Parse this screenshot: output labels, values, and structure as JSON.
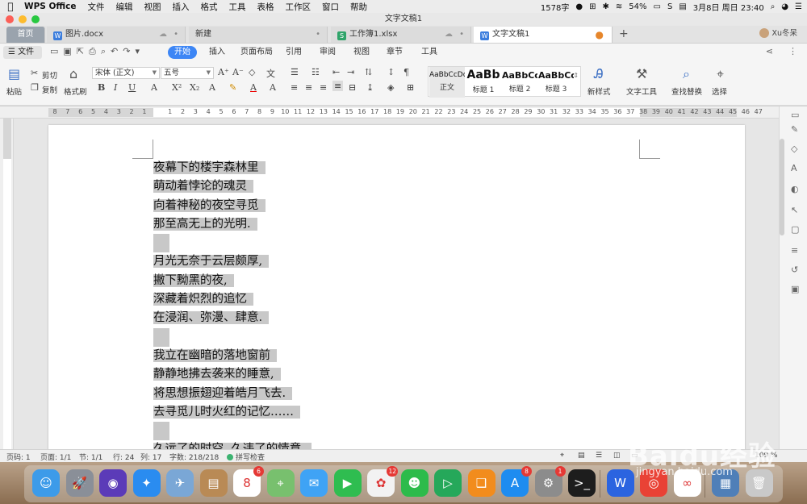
{
  "menubar": {
    "app": "WPS Office",
    "items": [
      "文件",
      "编辑",
      "视图",
      "插入",
      "格式",
      "工具",
      "表格",
      "工作区",
      "窗口",
      "帮助"
    ],
    "status": {
      "word_count": "1578字",
      "battery": "54%",
      "datetime": "3月8日 周日  23:40"
    }
  },
  "window": {
    "title": "文字文稿1"
  },
  "tabs": {
    "home": "首页",
    "items": [
      {
        "label": "图片.docx",
        "icon_color": "#3b7ddd"
      },
      {
        "label": "新建"
      },
      {
        "label": "工作簿1.xlsx",
        "icon_color": "#2fa46a"
      },
      {
        "label": "文字文稿1",
        "icon_color": "#3b7ddd"
      }
    ],
    "new_tab": "+",
    "user": "Xu冬呆"
  },
  "menu_row": {
    "file": "文件",
    "tabs": [
      "开始",
      "插入",
      "页面布局",
      "引用",
      "审阅",
      "视图",
      "章节",
      "工具"
    ]
  },
  "ribbon": {
    "paste": "粘贴",
    "cut": "剪切",
    "copy": "复制",
    "format_painter": "格式刷",
    "font_name": "宋体 (正文)",
    "font_size": "五号",
    "styles": [
      {
        "sample": "AaBbCcDd",
        "name": "正文"
      },
      {
        "sample": "AaBb",
        "name": "标题 1"
      },
      {
        "sample": "AaBbCc",
        "name": "标题 2"
      },
      {
        "sample": "AaBbCc",
        "name": "标题 3"
      }
    ],
    "new_style": "新样式",
    "text_tools": "文字工具",
    "find_replace": "查找替换",
    "select": "选择"
  },
  "ruler": {
    "ticks": [
      "8",
      "7",
      "6",
      "5",
      "4",
      "3",
      "2",
      "1",
      "",
      "1",
      "2",
      "3",
      "4",
      "5",
      "6",
      "7",
      "8",
      "9",
      "10",
      "11",
      "12",
      "13",
      "14",
      "15",
      "16",
      "17",
      "18",
      "19",
      "20",
      "21",
      "22",
      "23",
      "24",
      "25",
      "26",
      "27",
      "28",
      "29",
      "30",
      "31",
      "32",
      "33",
      "34",
      "35",
      "36",
      "37",
      "38",
      "39",
      "40",
      "41",
      "42",
      "43",
      "44",
      "45",
      "46",
      "47"
    ]
  },
  "document": {
    "lines": [
      "夜幕下的楼宇森林里",
      "萌动着悖论的魂灵",
      "向着神秘的夜空寻觅",
      "那至高无上的光明.",
      "",
      "月光无奈于云层颇厚,",
      "撇下黝黑的夜,",
      "深藏着炽烈的追忆",
      "在浸润、弥漫、肆意.",
      "",
      "我立在幽暗的落地窗前",
      "静静地拂去袭来的睡意,",
      "将思想振翅迎着皓月飞去.",
      "去寻觅儿时火红的记忆……",
      "",
      "久远了的时空, 久违了的情意."
    ]
  },
  "statusbar": {
    "page_no": "页码: 1",
    "pages": "页面: 1/1",
    "section": "节: 1/1",
    "row": "行: 24",
    "col": "列: 17",
    "chars": "字数: 218/218",
    "spell": "拼写检查",
    "zoom": "109 %"
  },
  "dock": {
    "apps": [
      {
        "name": "finder",
        "color": "#3d9be9",
        "glyph": "☺"
      },
      {
        "name": "launchpad",
        "color": "#8a8f98",
        "glyph": "🚀"
      },
      {
        "name": "siri",
        "color": "#5b3bb8",
        "glyph": "◉"
      },
      {
        "name": "safari",
        "color": "#2a8cf0",
        "glyph": "✦"
      },
      {
        "name": "preview",
        "color": "#7aa7d6",
        "glyph": "✈"
      },
      {
        "name": "contacts",
        "color": "#b98a55",
        "glyph": "▤"
      },
      {
        "name": "calendar",
        "color": "#ffffff",
        "glyph": "8",
        "badge": "6"
      },
      {
        "name": "maps",
        "color": "#78c06e",
        "glyph": "⌖"
      },
      {
        "name": "messages",
        "color": "#3fa3f5",
        "glyph": "✉"
      },
      {
        "name": "facetime",
        "color": "#2fbd50",
        "glyph": "▶"
      },
      {
        "name": "photos",
        "color": "#f2f2f2",
        "glyph": "✿",
        "badge": "12"
      },
      {
        "name": "wechat",
        "color": "#2dbb4b",
        "glyph": "☻"
      },
      {
        "name": "media",
        "color": "#25a85a",
        "glyph": "▷"
      },
      {
        "name": "books",
        "color": "#f28c1d",
        "glyph": "❑"
      },
      {
        "name": "app-store",
        "color": "#1e8cf0",
        "glyph": "A",
        "badge": "8"
      },
      {
        "name": "system-preferences",
        "color": "#8c8c8c",
        "glyph": "⚙",
        "badge": "1"
      },
      {
        "name": "terminal",
        "color": "#1d1d1d",
        "glyph": ">_"
      },
      {
        "name": "wps",
        "color": "#2b64e0",
        "glyph": "W"
      },
      {
        "name": "chrome",
        "color": "#e94235",
        "glyph": "◎"
      },
      {
        "name": "baidu-netdisk",
        "color": "#ffffff",
        "glyph": "∞"
      },
      {
        "name": "downloads",
        "color": "#4f7fb8",
        "glyph": "▦"
      },
      {
        "name": "trash",
        "color": "#c9c9c9",
        "glyph": "🗑"
      }
    ]
  },
  "colors": {
    "accent": "#3d86f5",
    "selection": "#c8c8c8"
  }
}
